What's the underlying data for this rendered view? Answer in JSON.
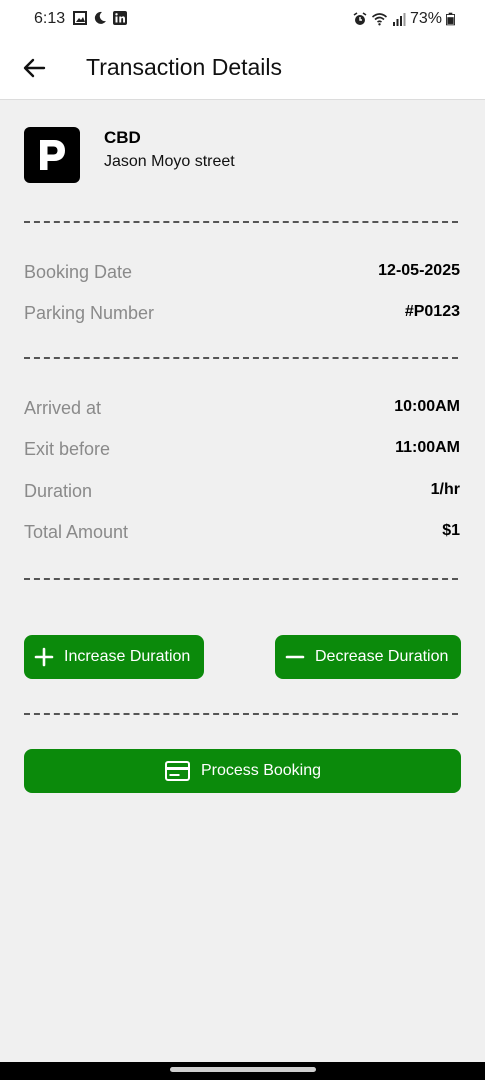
{
  "status_bar": {
    "time": "6:13",
    "battery": "73%",
    "icons_left": [
      "gallery-icon",
      "moon-icon",
      "linkedin-icon"
    ],
    "icons_right": [
      "alarm-icon",
      "wifi-icon",
      "signal-icon",
      "battery-icon"
    ]
  },
  "app_bar": {
    "title": "Transaction Details",
    "back_icon": "arrow-left-icon"
  },
  "lot": {
    "logo_letter": "P",
    "name": "CBD",
    "address": "Jason Moyo street"
  },
  "booking": {
    "date_label": "Booking Date",
    "date_value": "12-05-2025",
    "parking_label": "Parking Number",
    "parking_value": "#P0123"
  },
  "timing": {
    "arrived_label": "Arrived at",
    "arrived_value": "10:00AM",
    "exit_label": "Exit before",
    "exit_value": "11:00AM",
    "duration_label": "Duration",
    "duration_value": "1/hr",
    "total_label": "Total Amount",
    "total_value": "$1"
  },
  "actions": {
    "increase_label": "Increase Duration",
    "decrease_label": "Decrease Duration",
    "process_label": "Process Booking"
  },
  "colors": {
    "accent": "#0b8a0b",
    "background": "#f0f0f0"
  }
}
